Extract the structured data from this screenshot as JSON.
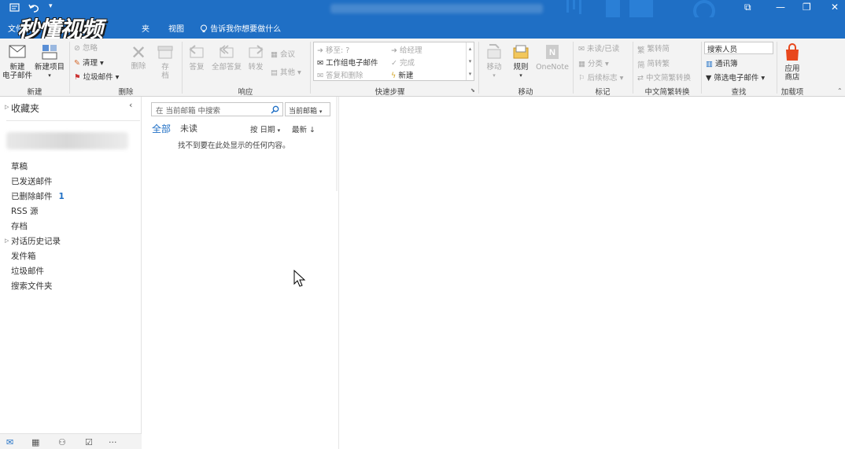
{
  "titlebar": {
    "blurred_title": "",
    "undo_icon": "undo-icon",
    "customize_icon": "qat-more-icon"
  },
  "window_controls": [
    "restore-ribbon-icon",
    "minimize-icon",
    "maximize-icon",
    "close-icon"
  ],
  "tabs": {
    "file": "文件",
    "file_partial": "夹",
    "view": "视图"
  },
  "tell_me": "告诉我你想要做什么",
  "watermark": "秒懂视频",
  "ribbon": {
    "new": {
      "new_email": "新建\n电子邮件",
      "new_items": "新建项目",
      "group": "新建"
    },
    "delete": {
      "ignore": "忽略",
      "cleanup": "清理",
      "junk": "垃圾邮件",
      "delete": "删除",
      "archive": "存档",
      "group": "删除"
    },
    "respond": {
      "reply": "答复",
      "reply_all": "全部答复",
      "forward": "转发",
      "meeting": "会议",
      "more": "其他",
      "group": "响应"
    },
    "quick_steps": {
      "move_to": "移至: ?",
      "team_email": "工作组电子邮件",
      "reply_delete": "答复和删除",
      "to_manager": "给经理",
      "done": "完成",
      "create_new": "新建",
      "group": "快速步骤"
    },
    "move": {
      "move": "移动",
      "rules": "规则",
      "onenote": "OneNote",
      "group": "移动"
    },
    "tags": {
      "unread_read": "未读/已读",
      "categorize": "分类",
      "follow_up": "后续标志",
      "group": "标记"
    },
    "chinese": {
      "to_simplified": "繁转简",
      "to_traditional": "简转繁",
      "convert": "中文简繁转换",
      "group": "中文简繁转换"
    },
    "find": {
      "search_people": "搜索人员",
      "address_book": "通讯簿",
      "filter_email": "筛选电子邮件",
      "group": "查找"
    },
    "addins": {
      "store": "应用\n商店",
      "group": "加载项"
    }
  },
  "folders": {
    "favorites": "收藏夹",
    "items": [
      {
        "label": "草稿"
      },
      {
        "label": "已发送邮件"
      },
      {
        "label": "已删除邮件",
        "count": "1"
      },
      {
        "label": "RSS 源"
      },
      {
        "label": "存档"
      },
      {
        "label": "对话历史记录"
      },
      {
        "label": "发件箱"
      },
      {
        "label": "垃圾邮件"
      },
      {
        "label": "搜索文件夹"
      }
    ]
  },
  "message_list": {
    "search_placeholder": "在 当前邮箱 中搜索",
    "scope": "当前邮箱",
    "filter_all": "全部",
    "filter_unread": "未读",
    "sort_by": "按 日期",
    "sort_order": "最新 ↓",
    "empty_message": "找不到要在此处显示的任何内容。"
  },
  "colors": {
    "brand": "#1f6fc5",
    "accent_count": "#1f6fc5",
    "store_icon": "#e8471c"
  }
}
